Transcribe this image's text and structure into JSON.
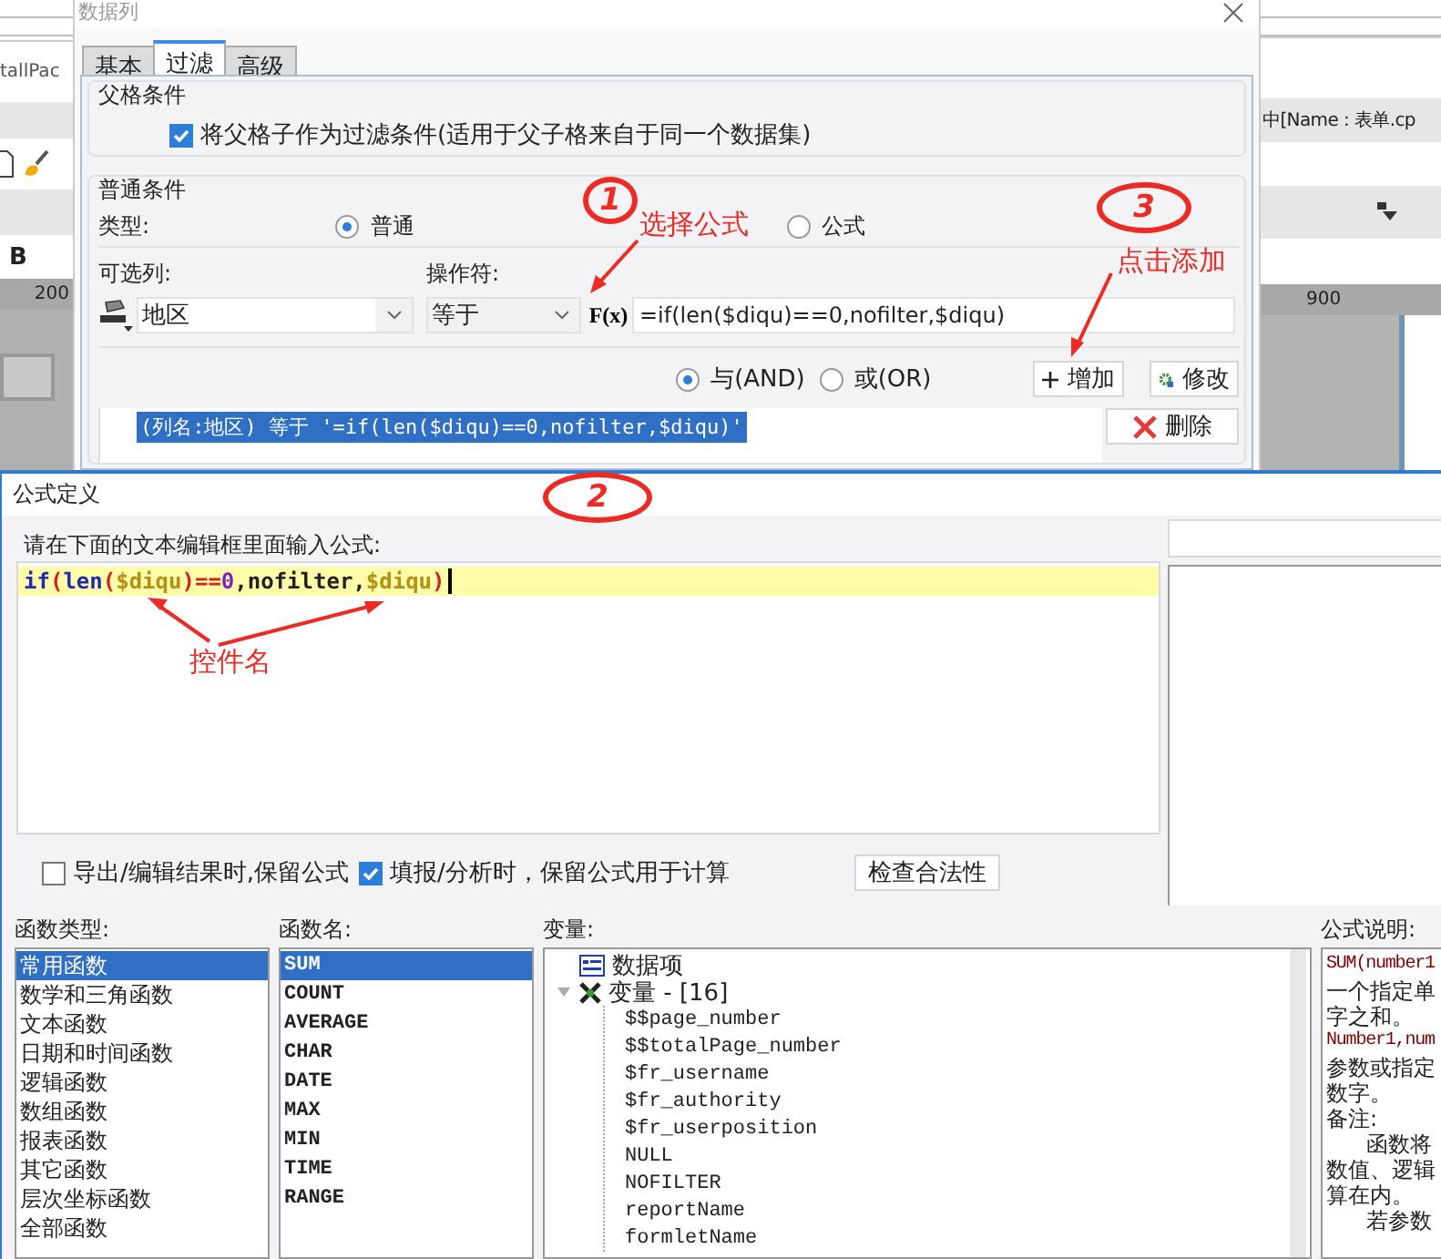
{
  "background_app": {
    "left_text": "tallPac",
    "bold_button": "B",
    "left_ruler": "200",
    "right_text": "中[Name : 表单.cp",
    "right_ruler": "900"
  },
  "column_dialog": {
    "title": "数据列",
    "tabs": [
      {
        "label": "基本",
        "selected": false
      },
      {
        "label": "过滤",
        "selected": true
      },
      {
        "label": "高级",
        "selected": false
      }
    ],
    "parent_group": {
      "title": "父格条件",
      "checkbox": {
        "label": "将父格子作为过滤条件(适用于父子格来自于同一个数据集)",
        "checked": true
      }
    },
    "normal_group": {
      "title": "普通条件",
      "type_label": "类型:",
      "type_options": [
        {
          "label": "普通",
          "selected": true
        },
        {
          "label": "公式",
          "selected": false
        }
      ],
      "column_label": "可选列:",
      "operator_label": "操作符:",
      "column_value": "地区",
      "operator_value": "等于",
      "formula_button": "F(x)",
      "formula_value": "=if(len($diqu)==0,nofilter,$diqu)",
      "logic_options": [
        {
          "label": "与(AND)",
          "selected": true
        },
        {
          "label": "或(OR)",
          "selected": false
        }
      ],
      "add_button": "增加",
      "edit_button": "修改",
      "conditions": [
        {
          "text": "(列名:地区) 等于 '=if(len($diqu)==0,nofilter,$diqu)'",
          "selected": true
        }
      ],
      "delete_button": "删除"
    }
  },
  "formula_dialog": {
    "title": "公式定义",
    "prompt": "请在下面的文本编辑框里面输入公式:",
    "code": [
      {
        "kind": "keyword",
        "text": "if"
      },
      {
        "kind": "paren",
        "text": "("
      },
      {
        "kind": "keyword",
        "text": "len"
      },
      {
        "kind": "paren",
        "text": "("
      },
      {
        "kind": "variable",
        "text": "$diqu"
      },
      {
        "kind": "paren",
        "text": ")"
      },
      {
        "kind": "operator",
        "text": "=="
      },
      {
        "kind": "number",
        "text": "0"
      },
      {
        "kind": "plain",
        "text": ",nofilter,"
      },
      {
        "kind": "variable",
        "text": "$diqu"
      },
      {
        "kind": "paren",
        "text": ")"
      }
    ],
    "options": [
      {
        "label": "导出/编辑结果时,保留公式",
        "checked": false
      },
      {
        "label": "填报/分析时，保留公式用于计算",
        "checked": true
      }
    ],
    "check_button": "检查合法性",
    "function_types": {
      "label": "函数类型:",
      "items": [
        {
          "label": "常用函数",
          "selected": true
        },
        {
          "label": "数学和三角函数",
          "selected": false
        },
        {
          "label": "文本函数",
          "selected": false
        },
        {
          "label": "日期和时间函数",
          "selected": false
        },
        {
          "label": "逻辑函数",
          "selected": false
        },
        {
          "label": "数组函数",
          "selected": false
        },
        {
          "label": "报表函数",
          "selected": false
        },
        {
          "label": "其它函数",
          "selected": false
        },
        {
          "label": "层次坐标函数",
          "selected": false
        },
        {
          "label": "全部函数",
          "selected": false
        }
      ]
    },
    "function_names": {
      "label": "函数名:",
      "items": [
        {
          "label": "SUM",
          "selected": true
        },
        {
          "label": "COUNT",
          "selected": false
        },
        {
          "label": "AVERAGE",
          "selected": false
        },
        {
          "label": "CHAR",
          "selected": false
        },
        {
          "label": "DATE",
          "selected": false
        },
        {
          "label": "MAX",
          "selected": false
        },
        {
          "label": "MIN",
          "selected": false
        },
        {
          "label": "TIME",
          "selected": false
        },
        {
          "label": "RANGE",
          "selected": false
        }
      ]
    },
    "variables": {
      "label": "变量:",
      "tree": [
        {
          "kind": "dataset",
          "label": "数据项"
        },
        {
          "kind": "variables",
          "label": "变量 - [16]",
          "expanded": true,
          "children": [
            {
              "label": "$$page_number"
            },
            {
              "label": "$$totalPage_number"
            },
            {
              "label": "$fr_username"
            },
            {
              "label": "$fr_authority"
            },
            {
              "label": "$fr_userposition"
            },
            {
              "label": "NULL"
            },
            {
              "label": "NOFILTER"
            },
            {
              "label": "reportName"
            },
            {
              "label": "formletName"
            }
          ]
        }
      ]
    },
    "description": {
      "label": "公式说明:",
      "lines": [
        {
          "kind": "code",
          "text": "SUM(number1"
        },
        {
          "kind": "text",
          "text": "一个指定单"
        },
        {
          "kind": "text",
          "text": "字之和。"
        },
        {
          "kind": "code",
          "text": "Number1,num"
        },
        {
          "kind": "text",
          "text": "参数或指定"
        },
        {
          "kind": "text",
          "text": "数字。"
        },
        {
          "kind": "text",
          "text": "备注:"
        },
        {
          "kind": "indent",
          "text": "函数将"
        },
        {
          "kind": "text",
          "text": "数值、逻辑"
        },
        {
          "kind": "text",
          "text": "算在内。"
        },
        {
          "kind": "indent",
          "text": "若参数"
        }
      ]
    }
  },
  "annotations": [
    {
      "kind": "circled",
      "text": "1"
    },
    {
      "kind": "label",
      "text": "选择公式"
    },
    {
      "kind": "circled",
      "text": "3"
    },
    {
      "kind": "label",
      "text": "点击添加"
    },
    {
      "kind": "circled",
      "text": "2"
    },
    {
      "kind": "label",
      "text": "控件名"
    }
  ]
}
